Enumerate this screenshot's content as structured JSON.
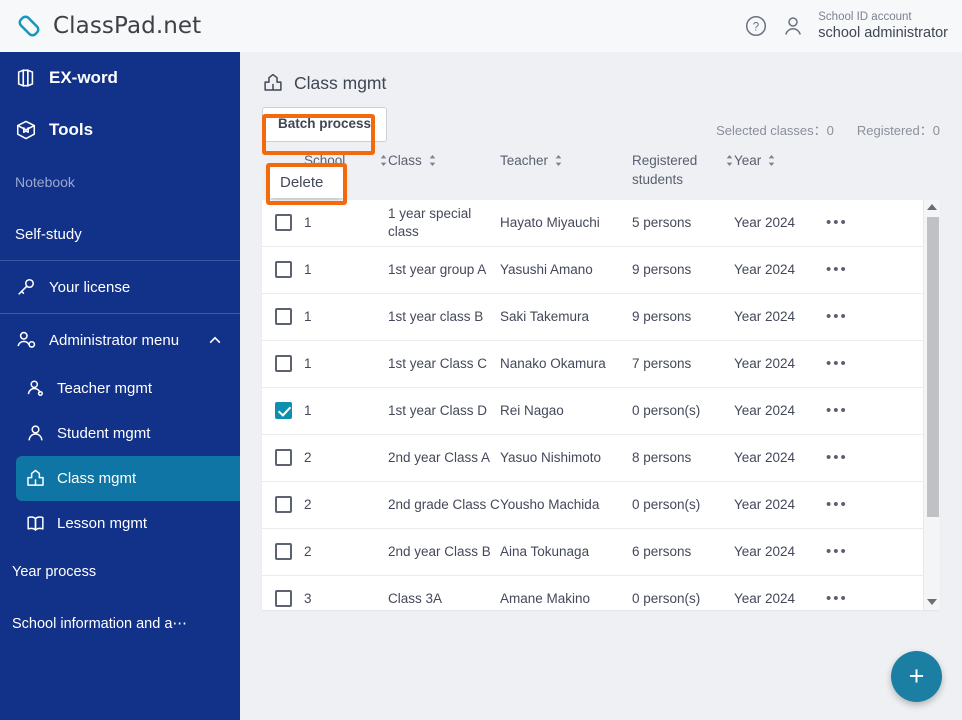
{
  "header": {
    "brand": "ClassPad.net",
    "brand_logo_icon": "chain-link-logo-icon",
    "help_icon": "question-mark-circle-icon",
    "account_icon": "person-icon",
    "account_label": "School ID account",
    "account_name": "school administrator"
  },
  "sidebar": {
    "bg_color": "#123189",
    "active_color": "#0e75a4",
    "top_items": [
      {
        "label": "EX-word",
        "icon": "dictionary-book-icon"
      },
      {
        "label": "Tools",
        "icon": "toolbox-icon"
      },
      {
        "label": "Notebook",
        "icon": "none"
      },
      {
        "label": "Self-study",
        "icon": "none"
      }
    ],
    "license_item": {
      "label": "Your license",
      "icon": "key-icon"
    },
    "admin_menu": {
      "label": "Administrator menu",
      "icon": "admin-person-gear-icon",
      "chevron": "chevron-up-icon"
    },
    "admin_items": [
      {
        "label": "Teacher mgmt",
        "icon": "teacher-person-icon",
        "active": false
      },
      {
        "label": "Student mgmt",
        "icon": "student-person-icon",
        "active": false
      },
      {
        "label": "Class mgmt",
        "icon": "school-building-icon",
        "active": true
      },
      {
        "label": "Lesson mgmt",
        "icon": "open-book-icon",
        "active": false
      }
    ],
    "plain_items": [
      {
        "label": "Year process"
      },
      {
        "label": "School information and a⋯"
      }
    ]
  },
  "main": {
    "page_title": "Class mgmt",
    "page_title_icon": "school-building-icon",
    "batch_button": "Batch process",
    "dropdown": {
      "items": [
        "Delete"
      ]
    },
    "highlight_color": "#f26a0d",
    "counters": [
      "Selected classes：0",
      "Registered：0"
    ],
    "table": {
      "columns": [
        {
          "key": "check",
          "label": "",
          "sortable": false
        },
        {
          "key": "year",
          "label": "School year",
          "sortable": true
        },
        {
          "key": "class",
          "label": "Class",
          "sortable": true
        },
        {
          "key": "teacher",
          "label": "Teacher",
          "sortable": true
        },
        {
          "key": "reg",
          "label": "Registered students",
          "sortable": true
        },
        {
          "key": "yr",
          "label": "Year",
          "sortable": true
        },
        {
          "key": "more",
          "label": "",
          "sortable": false
        }
      ],
      "rows": [
        {
          "checked": false,
          "year": "1",
          "class": "1 year special class",
          "teacher": "Hayato Miyauchi",
          "reg": "5 persons",
          "yr": "Year 2024",
          "more": "•••"
        },
        {
          "checked": false,
          "year": "1",
          "class": "1st year group A",
          "teacher": "Yasushi Amano",
          "reg": "9 persons",
          "yr": "Year 2024",
          "more": "•••"
        },
        {
          "checked": false,
          "year": "1",
          "class": "1st year class B",
          "teacher": "Saki Takemura",
          "reg": "9 persons",
          "yr": "Year 2024",
          "more": "•••"
        },
        {
          "checked": false,
          "year": "1",
          "class": "1st year Class C",
          "teacher": "Nanako Okamura",
          "reg": "7 persons",
          "yr": "Year 2024",
          "more": "•••"
        },
        {
          "checked": true,
          "year": "1",
          "class": "1st year Class D",
          "teacher": "Rei Nagao",
          "reg": "0 person(s)",
          "yr": "Year 2024",
          "more": "•••"
        },
        {
          "checked": false,
          "year": "2",
          "class": "2nd year Class A",
          "teacher": "Yasuo Nishimoto",
          "reg": "8 persons",
          "yr": "Year 2024",
          "more": "•••"
        },
        {
          "checked": false,
          "year": "2",
          "class": "2nd grade Class C",
          "teacher": "Yousho Machida",
          "reg": "0 person(s)",
          "yr": "Year 2024",
          "more": "•••"
        },
        {
          "checked": false,
          "year": "2",
          "class": "2nd year Class B",
          "teacher": "Aina Tokunaga",
          "reg": "6 persons",
          "yr": "Year 2024",
          "more": "•••"
        },
        {
          "checked": false,
          "year": "3",
          "class": "Class 3A",
          "teacher": "Amane Makino",
          "reg": "0 person(s)",
          "yr": "Year 2024",
          "more": "•••"
        }
      ]
    },
    "fab": {
      "label": "+",
      "icon": "plus-icon",
      "color": "#1a7fa3"
    },
    "scrollbar": {
      "up_icon": "triangle-up-icon",
      "down_icon": "triangle-down-icon"
    }
  }
}
